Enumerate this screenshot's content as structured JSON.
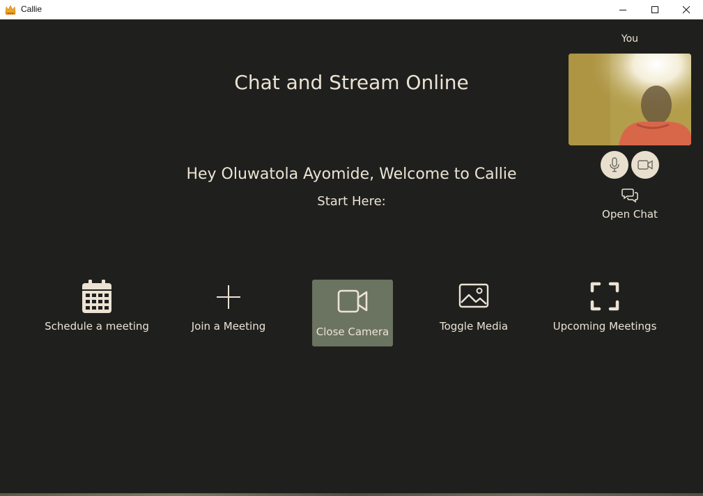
{
  "window": {
    "title": "Callie"
  },
  "main": {
    "heading": "Chat and Stream Online",
    "welcome": "Hey Oluwatola Ayomide, Welcome to Callie",
    "start_here": "Start Here:"
  },
  "self_view": {
    "label": "You",
    "open_chat": "Open Chat"
  },
  "actions": [
    {
      "label": "Schedule a meeting",
      "icon": "calendar-icon"
    },
    {
      "label": "Join a Meeting",
      "icon": "plus-icon"
    },
    {
      "label": "Close Camera",
      "icon": "video-camera-icon",
      "active": true
    },
    {
      "label": "Toggle Media",
      "icon": "image-icon"
    },
    {
      "label": "Upcoming Meetings",
      "icon": "fullscreen-icon"
    }
  ],
  "colors": {
    "background": "#1f201e",
    "text": "#ece3d4",
    "active_button": "#6b7361",
    "round_button": "#e9dfcf"
  }
}
